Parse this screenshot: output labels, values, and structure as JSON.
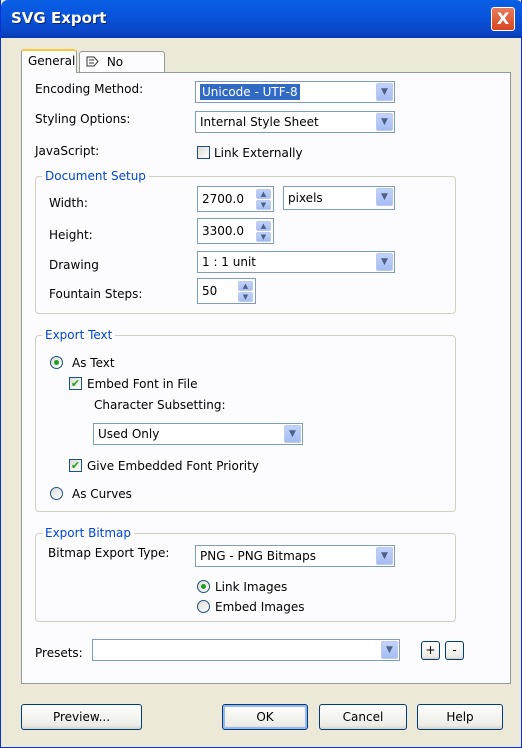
{
  "window": {
    "title": "SVG Export",
    "close_glyph": "X"
  },
  "tabs": [
    {
      "label": "General"
    },
    {
      "label": "No Issues",
      "icon": "issues-icon"
    }
  ],
  "general": {
    "encoding": {
      "label": "Encoding Method:",
      "value": "Unicode - UTF-8"
    },
    "styling": {
      "label": "Styling Options:",
      "value": "Internal Style Sheet"
    },
    "javascript": {
      "label": "JavaScript:",
      "checkbox_label": "Link Externally",
      "checked": false
    }
  },
  "document_setup": {
    "title": "Document Setup",
    "width": {
      "label": "Width:",
      "value": "2700.0"
    },
    "units": {
      "value": "pixels"
    },
    "height": {
      "label": "Height:",
      "value": "3300.0"
    },
    "drawing": {
      "label": "Drawing",
      "value": "1 : 1 unit"
    },
    "fountain": {
      "label": "Fountain Steps:",
      "value": "50"
    }
  },
  "export_text": {
    "title": "Export Text",
    "as_text": {
      "label": "As Text",
      "checked": true
    },
    "embed_font": {
      "label": "Embed Font in File",
      "checked": true
    },
    "subsetting": {
      "label": "Character Subsetting:",
      "value": "Used Only"
    },
    "priority": {
      "label": "Give Embedded Font Priority",
      "checked": true
    },
    "as_curves": {
      "label": "As Curves",
      "checked": false
    }
  },
  "export_bitmap": {
    "title": "Export Bitmap",
    "type": {
      "label": "Bitmap Export Type:",
      "value": "PNG - PNG Bitmaps"
    },
    "link_images": {
      "label": "Link Images",
      "checked": true
    },
    "embed_images": {
      "label": "Embed Images",
      "checked": false
    }
  },
  "presets": {
    "label": "Presets:",
    "value": "",
    "add": "+",
    "remove": "-"
  },
  "buttons": {
    "preview": "Preview...",
    "ok": "OK",
    "cancel": "Cancel",
    "help": "Help"
  },
  "glyphs": {
    "dropdown": "▼",
    "up": "▲",
    "down": "▼",
    "check": "✔"
  }
}
